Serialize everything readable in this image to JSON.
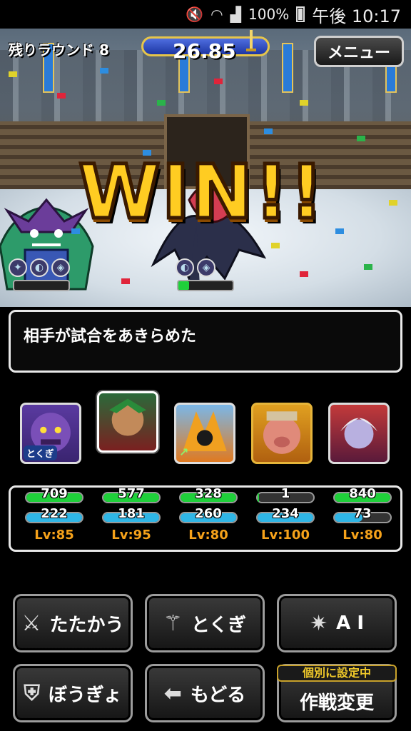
{
  "status_bar": {
    "battery": "100%",
    "time": "午後 10:17",
    "icons": [
      "mute-icon",
      "wifi-icon",
      "signal-icon",
      "battery-icon"
    ]
  },
  "battle": {
    "round_label": "残りラウンド 8",
    "timer": "26.85",
    "menu_label": "メニュー",
    "result": "WIN!!",
    "enemy_left_hp": 0,
    "enemy_right_hp": 0.2
  },
  "message": "相手が試合をあきらめた",
  "party": [
    {
      "name": "purple-beast",
      "badge": "とくぎ",
      "hp": "709",
      "mp": "222",
      "lv": "Lv:85",
      "hp_frac": 1.0,
      "mp_frac": 1.0
    },
    {
      "name": "green-warrior",
      "hp": "577",
      "mp": "181",
      "lv": "Lv:95",
      "hp_frac": 1.0,
      "mp_frac": 1.0
    },
    {
      "name": "ice-fire-spirit",
      "hp": "328",
      "mp": "260",
      "lv": "Lv:80",
      "hp_frac": 1.0,
      "mp_frac": 1.0
    },
    {
      "name": "boar-king",
      "hp": "1",
      "mp": "234",
      "lv": "Lv:100",
      "hp_frac": 0.03,
      "mp_frac": 1.0
    },
    {
      "name": "vampire-girl",
      "hp": "840",
      "mp": "73",
      "lv": "Lv:80",
      "hp_frac": 1.0,
      "mp_frac": 0.5
    }
  ],
  "commands": {
    "fight": "たたかう",
    "skill": "とくぎ",
    "ai": "A I",
    "defend": "ぼうぎょ",
    "back": "もどる",
    "strategy": "作戦変更",
    "strategy_tag": "個別に設定中"
  },
  "colors": {
    "hp": "#1fd03a",
    "mp": "#2fb6e6",
    "level": "#f6a21a",
    "win": "#ffcc22"
  }
}
